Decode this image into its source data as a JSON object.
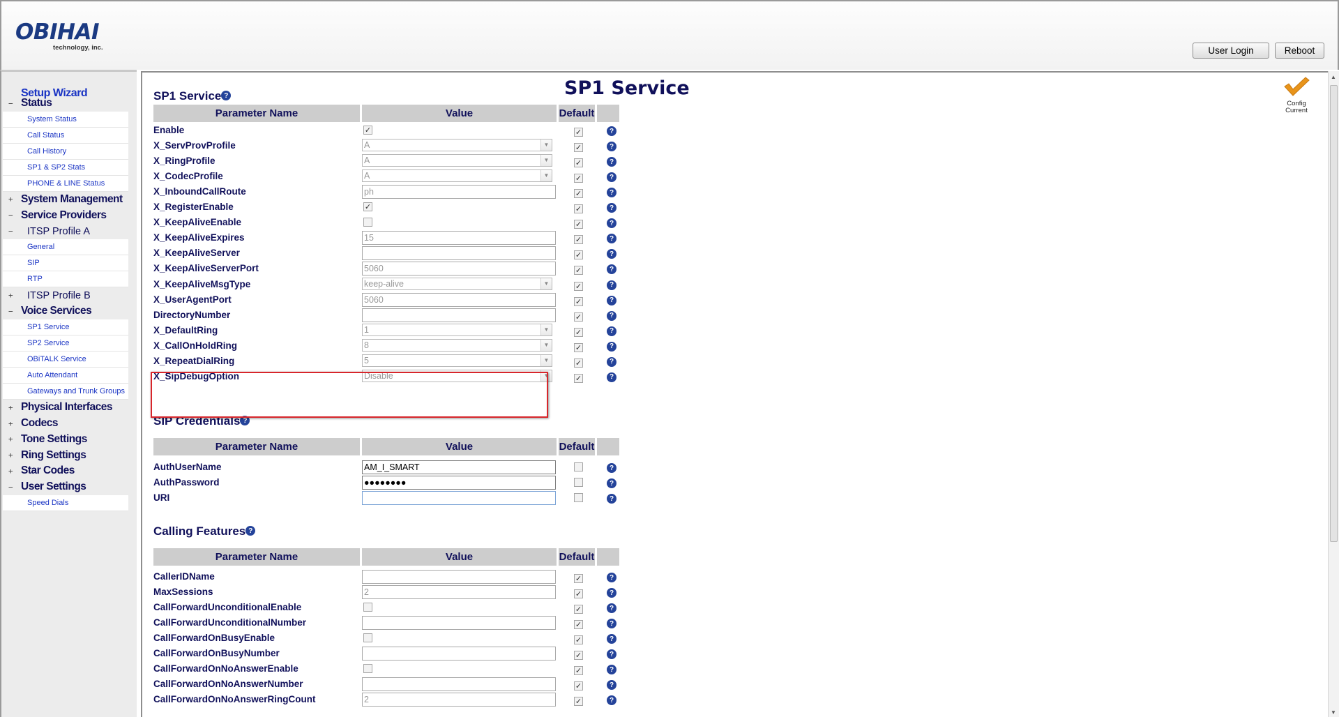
{
  "header": {
    "logo_name": "OBIHAI",
    "logo_sub": "technology, inc.",
    "user_login_label": "User Login",
    "reboot_label": "Reboot"
  },
  "sidebar": {
    "setup_wizard": "Setup Wizard",
    "sections": [
      {
        "toggle": "−",
        "label": "Status",
        "items": [
          "System Status",
          "Call Status",
          "Call History",
          "SP1 & SP2 Stats",
          "PHONE & LINE Status"
        ]
      },
      {
        "toggle": "+",
        "label": "System Management"
      },
      {
        "toggle": "−",
        "label": "Service Providers"
      },
      {
        "toggle": "−",
        "label": "ITSP Profile A",
        "items": [
          "General",
          "SIP",
          "RTP"
        ]
      },
      {
        "toggle": "+",
        "label": "ITSP Profile B"
      },
      {
        "toggle": "−",
        "label": "Voice Services",
        "items": [
          "SP1 Service",
          "SP2 Service",
          "OBiTALK Service",
          "Auto Attendant",
          "Gateways and Trunk Groups"
        ]
      },
      {
        "toggle": "+",
        "label": "Physical Interfaces"
      },
      {
        "toggle": "+",
        "label": "Codecs"
      },
      {
        "toggle": "+",
        "label": "Tone Settings"
      },
      {
        "toggle": "+",
        "label": "Ring Settings"
      },
      {
        "toggle": "+",
        "label": "Star Codes"
      },
      {
        "toggle": "−",
        "label": "User Settings",
        "items": [
          "Speed Dials"
        ]
      }
    ]
  },
  "main": {
    "page_title": "SP1 Service",
    "config_badge": {
      "line1": "Config",
      "line2": "Current",
      "icon": "checkmark-icon",
      "color": "#e8941a"
    },
    "help_glyph": "?",
    "columns": {
      "name": "Parameter Name",
      "value": "Value",
      "default": "Default"
    },
    "sections": [
      {
        "title": "SP1 Service",
        "rows": [
          {
            "name": "Enable",
            "type": "checkbox",
            "checked": true,
            "default": true
          },
          {
            "name": "X_ServProvProfile",
            "type": "select",
            "value": "A",
            "default": true
          },
          {
            "name": "X_RingProfile",
            "type": "select",
            "value": "A",
            "default": true
          },
          {
            "name": "X_CodecProfile",
            "type": "select",
            "value": "A",
            "default": true
          },
          {
            "name": "X_InboundCallRoute",
            "type": "text",
            "value": "ph",
            "default": true
          },
          {
            "name": "X_RegisterEnable",
            "type": "checkbox",
            "checked": true,
            "default": true
          },
          {
            "name": "X_KeepAliveEnable",
            "type": "checkbox",
            "checked": false,
            "default": true
          },
          {
            "name": "X_KeepAliveExpires",
            "type": "text",
            "value": "15",
            "default": true
          },
          {
            "name": "X_KeepAliveServer",
            "type": "text",
            "value": "",
            "default": true
          },
          {
            "name": "X_KeepAliveServerPort",
            "type": "text",
            "value": "5060",
            "default": true
          },
          {
            "name": "X_KeepAliveMsgType",
            "type": "select",
            "value": "keep-alive",
            "default": true
          },
          {
            "name": "X_UserAgentPort",
            "type": "text",
            "value": "5060",
            "default": true
          },
          {
            "name": "DirectoryNumber",
            "type": "text",
            "value": "",
            "default": true
          },
          {
            "name": "X_DefaultRing",
            "type": "select",
            "value": "1",
            "default": true
          },
          {
            "name": "X_CallOnHoldRing",
            "type": "select",
            "value": "8",
            "default": true
          },
          {
            "name": "X_RepeatDialRing",
            "type": "select",
            "value": "5",
            "default": true
          },
          {
            "name": "X_SipDebugOption",
            "type": "select",
            "value": "Disable",
            "default": true
          }
        ]
      },
      {
        "title": "SIP Credentials",
        "rows": [
          {
            "name": "AuthUserName",
            "type": "text",
            "value": "AM_I_SMART",
            "default": false,
            "active": true
          },
          {
            "name": "AuthPassword",
            "type": "text",
            "value": "●●●●●●●●",
            "default": false,
            "active": true
          },
          {
            "name": "URI",
            "type": "text",
            "value": "",
            "default": false,
            "active": true,
            "focus": true
          }
        ]
      },
      {
        "title": "Calling Features",
        "rows": [
          {
            "name": "CallerIDName",
            "type": "text",
            "value": "",
            "default": true
          },
          {
            "name": "MaxSessions",
            "type": "text",
            "value": "2",
            "default": true
          },
          {
            "name": "CallForwardUnconditionalEnable",
            "type": "checkbox",
            "checked": false,
            "default": true
          },
          {
            "name": "CallForwardUnconditionalNumber",
            "type": "text",
            "value": "",
            "default": true
          },
          {
            "name": "CallForwardOnBusyEnable",
            "type": "checkbox",
            "checked": false,
            "default": true
          },
          {
            "name": "CallForwardOnBusyNumber",
            "type": "text",
            "value": "",
            "default": true
          },
          {
            "name": "CallForwardOnNoAnswerEnable",
            "type": "checkbox",
            "checked": false,
            "default": true
          },
          {
            "name": "CallForwardOnNoAnswerNumber",
            "type": "text",
            "value": "",
            "default": true
          },
          {
            "name": "CallForwardOnNoAnswerRingCount",
            "type": "text",
            "value": "2",
            "default": true
          }
        ]
      }
    ]
  },
  "colors": {
    "navy": "#10105a",
    "link": "#1a34c4",
    "help": "#24439a",
    "highlight": "#d8262b"
  }
}
